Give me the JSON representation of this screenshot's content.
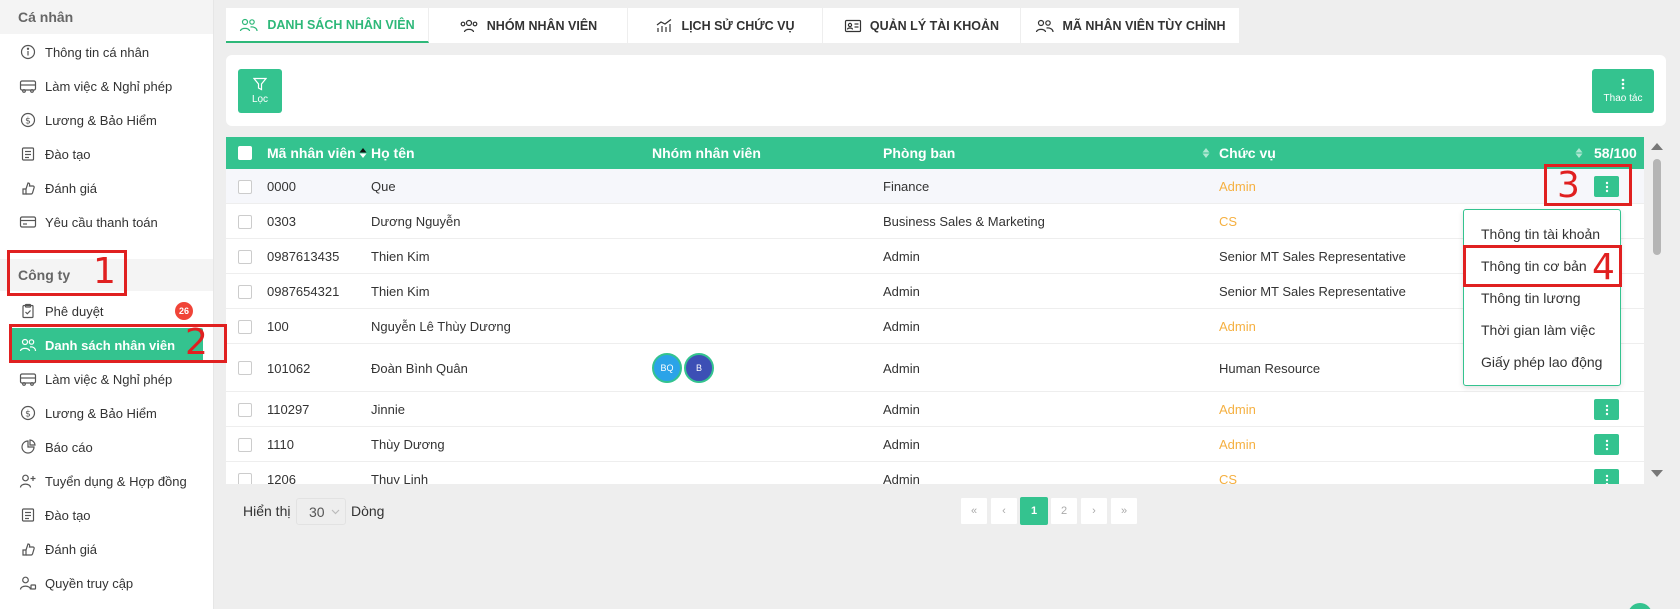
{
  "sidebar": {
    "personal_header": "Cá nhân",
    "personal_items": [
      {
        "label": "Thông tin cá nhân",
        "icon": "info-icon"
      },
      {
        "label": "Làm việc & Nghỉ phép",
        "icon": "bus-icon"
      },
      {
        "label": "Lương & Bảo Hiểm",
        "icon": "dollar-circle-icon"
      },
      {
        "label": "Đào tạo",
        "icon": "training-icon"
      },
      {
        "label": "Đánh giá",
        "icon": "review-icon"
      },
      {
        "label": "Yêu cầu thanh toán",
        "icon": "payment-request-icon"
      }
    ],
    "company_header": "Công ty",
    "company_items": [
      {
        "label": "Phê duyệt",
        "icon": "clipboard-check-icon",
        "badge": "26"
      },
      {
        "label": "Danh sách nhân viên",
        "icon": "users-icon"
      },
      {
        "label": "Làm việc & Nghỉ phép",
        "icon": "bus-icon"
      },
      {
        "label": "Lương & Bảo Hiểm",
        "icon": "dollar-circle-icon"
      },
      {
        "label": "Báo cáo",
        "icon": "pie-chart-icon"
      },
      {
        "label": "Tuyển dụng & Hợp đồng",
        "icon": "user-plus-icon"
      },
      {
        "label": "Đào tạo",
        "icon": "training-icon"
      },
      {
        "label": "Đánh giá",
        "icon": "review-icon"
      },
      {
        "label": "Quyền truy cập",
        "icon": "user-key-icon"
      }
    ]
  },
  "tabs": [
    {
      "label": "DANH SÁCH NHÂN VIÊN",
      "icon": "users-icon"
    },
    {
      "label": "NHÓM NHÂN VIÊN",
      "icon": "group-icon"
    },
    {
      "label": "LỊCH SỬ CHỨC VỤ",
      "icon": "chart-line-icon"
    },
    {
      "label": "QUẢN LÝ TÀI KHOẢN",
      "icon": "id-card-icon"
    },
    {
      "label": "MÃ NHÂN VIÊN TÙY CHỈNH",
      "icon": "users-icon"
    }
  ],
  "toolbar": {
    "filter_label": "Lọc",
    "actions_label": "Thao tác"
  },
  "table": {
    "headers": {
      "code": "Mã nhân viên",
      "name": "Họ tên",
      "group": "Nhóm nhân viên",
      "dept": "Phòng ban",
      "position": "Chức vụ",
      "count": "58/100"
    },
    "rows": [
      {
        "code": "0000",
        "name": "Que",
        "dept": "Finance",
        "position": "Admin",
        "position_orange": true
      },
      {
        "code": "0303",
        "name": "Dương Nguyễn",
        "dept": "Business Sales & Marketing",
        "position": "CS",
        "position_orange": true
      },
      {
        "code": "0987613435",
        "name": "Thien Kim",
        "dept": "Admin",
        "position": "Senior MT Sales Representative",
        "position_orange": false
      },
      {
        "code": "0987654321",
        "name": "Thien Kim",
        "dept": "Admin",
        "position": "Senior MT Sales Representative",
        "position_orange": false
      },
      {
        "code": "100",
        "name": "Nguyễn Lê Thùy Dương",
        "dept": "Admin",
        "position": "Admin",
        "position_orange": true
      },
      {
        "code": "101062",
        "name": "Đoàn Bình Quân",
        "dept": "Admin",
        "position": "Human Resource",
        "position_orange": false,
        "avatars": [
          "BQ",
          "B"
        ]
      },
      {
        "code": "110297",
        "name": "Jinnie",
        "dept": "Admin",
        "position": "Admin",
        "position_orange": true
      },
      {
        "code": "1110",
        "name": "Thùy Dương",
        "dept": "Admin",
        "position": "Admin",
        "position_orange": true
      },
      {
        "code": "1206",
        "name": "Thuy Linh",
        "dept": "Admin",
        "position": "CS",
        "position_orange": true
      }
    ]
  },
  "dropdown": {
    "items": [
      "Thông tin tài khoản",
      "Thông tin cơ bản",
      "Thông tin lương",
      "Thời gian làm việc",
      "Giấy phép lao động"
    ]
  },
  "pagination": {
    "show_label": "Hiển thị",
    "per_page": "30",
    "rows_label": "Dòng",
    "pages": [
      "«",
      "‹",
      "1",
      "2",
      "›",
      "»"
    ],
    "current": "1"
  },
  "annotations": [
    "1",
    "2",
    "3",
    "4"
  ],
  "colors": {
    "accent": "#34c38f",
    "orange": "#f5b041",
    "annotation": "#e02020",
    "badge": "#f04438"
  }
}
